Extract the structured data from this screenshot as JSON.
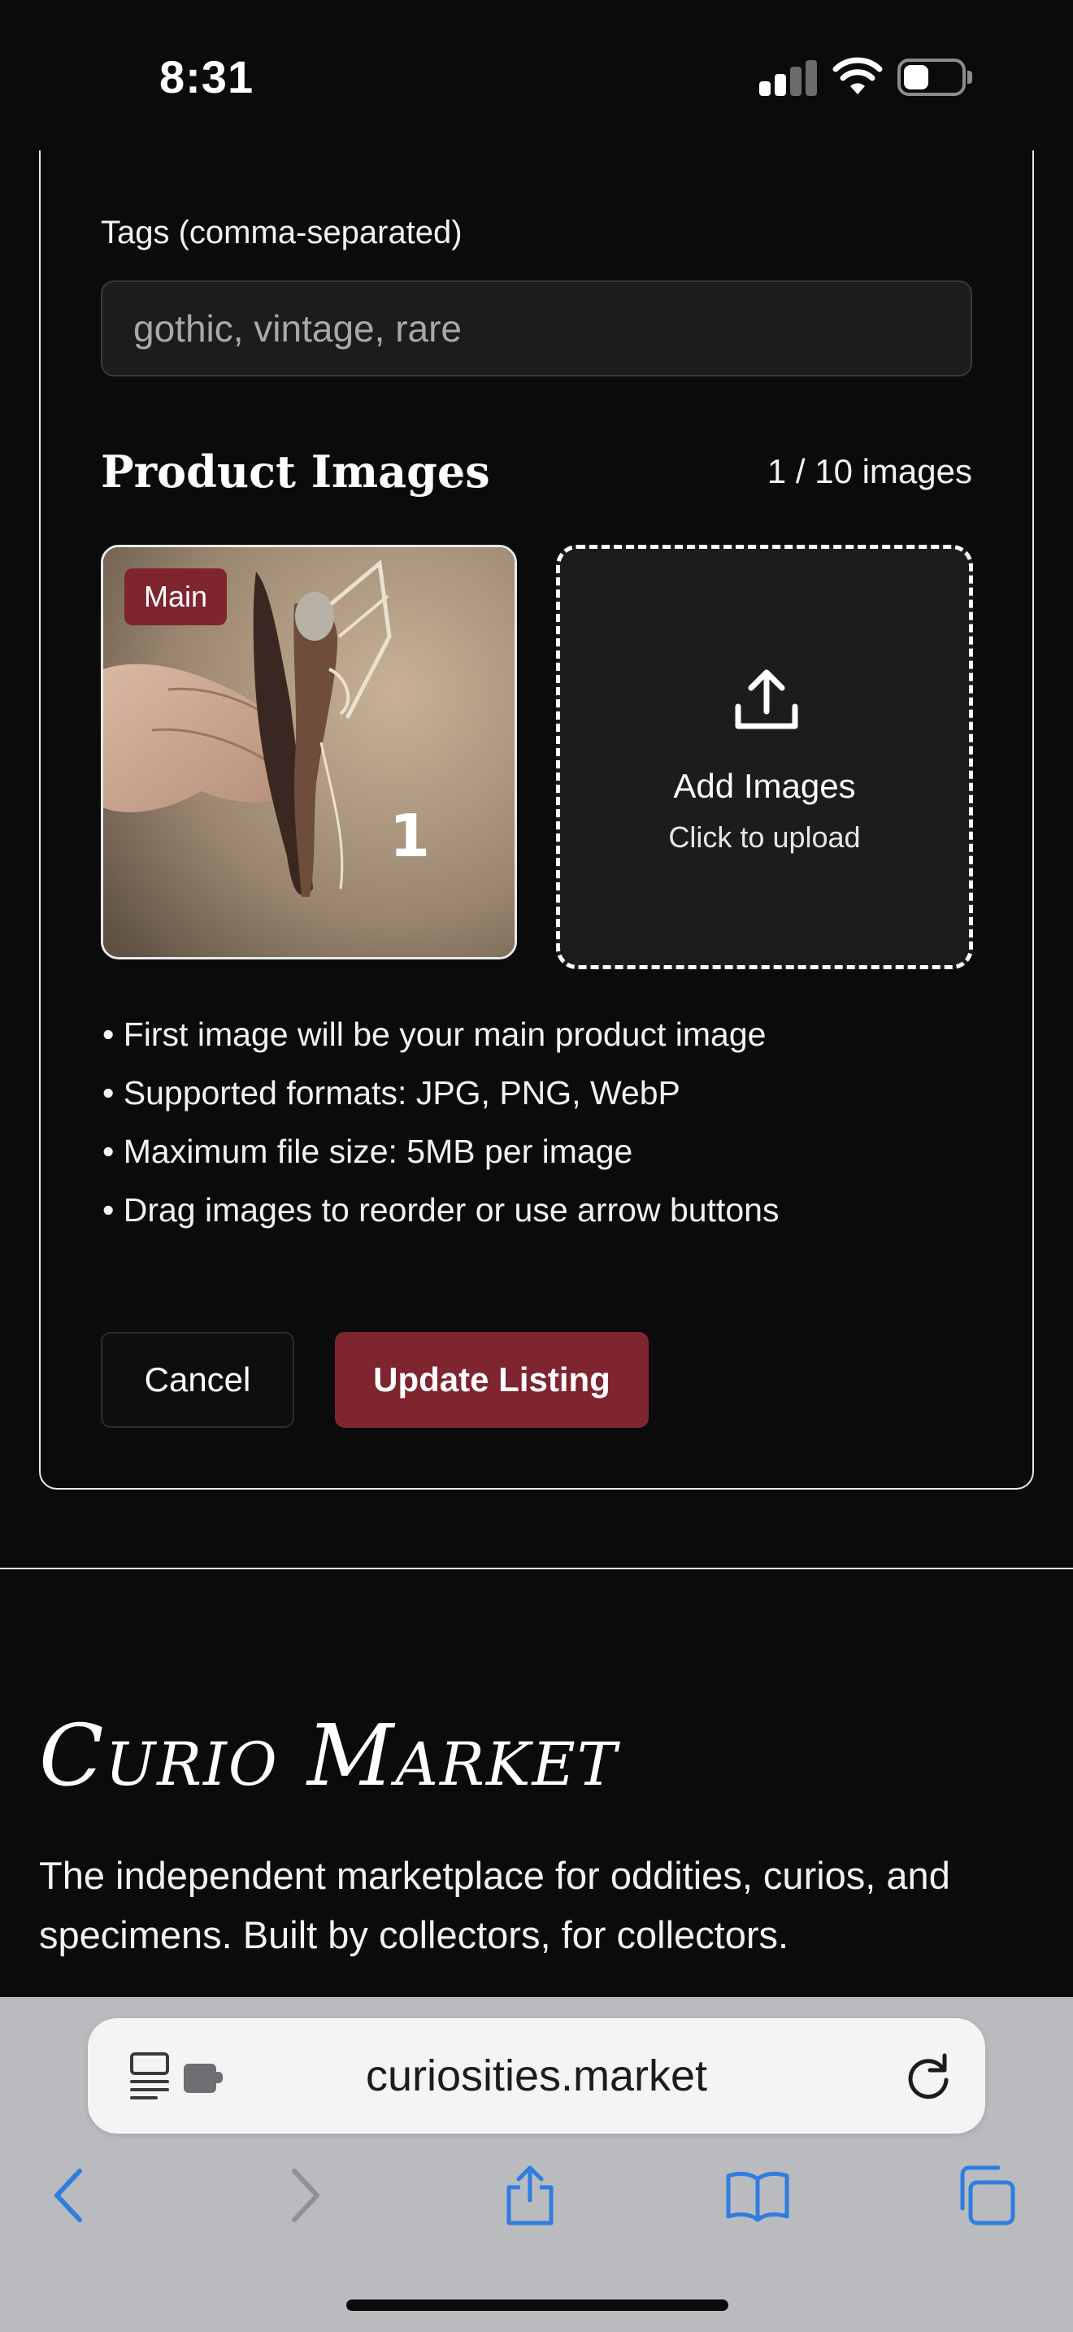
{
  "status_bar": {
    "time": "8:31",
    "signal_icon": "cellular-signal-icon",
    "wifi_icon": "wifi-icon",
    "battery_icon": "battery-icon",
    "battery_level": 0.3
  },
  "form": {
    "tags": {
      "label": "Tags (comma-separated)",
      "value": "gothic, vintage, rare"
    },
    "images": {
      "heading": "Product Images",
      "count_text": "1 / 10 images",
      "main_badge": "Main",
      "add_title": "Add Images",
      "add_subtitle": "Click to upload",
      "upload_icon": "upload-icon",
      "tips": [
        "• First image will be your main product image",
        "• Supported formats: JPG, PNG, WebP",
        "• Maximum file size: 5MB per image",
        "• Drag images to reorder or use arrow buttons"
      ]
    },
    "buttons": {
      "cancel": "Cancel",
      "update": "Update Listing"
    }
  },
  "footer": {
    "brand": "Curio Market",
    "tagline": "The independent marketplace for oddities, curios, and specimens. Built by collectors, for collectors."
  },
  "browser": {
    "url": "curiosities.market",
    "icons": [
      "reader-icon",
      "extension-icon",
      "reload-icon",
      "back-icon",
      "forward-icon",
      "share-icon",
      "bookmarks-icon",
      "tabs-icon"
    ]
  },
  "colors": {
    "accent": "#7e2530",
    "background": "#0b0b0b",
    "input_background": "#1c1c1e",
    "browser_chrome": "#b9bbbe",
    "link_blue": "#2f7de1"
  }
}
